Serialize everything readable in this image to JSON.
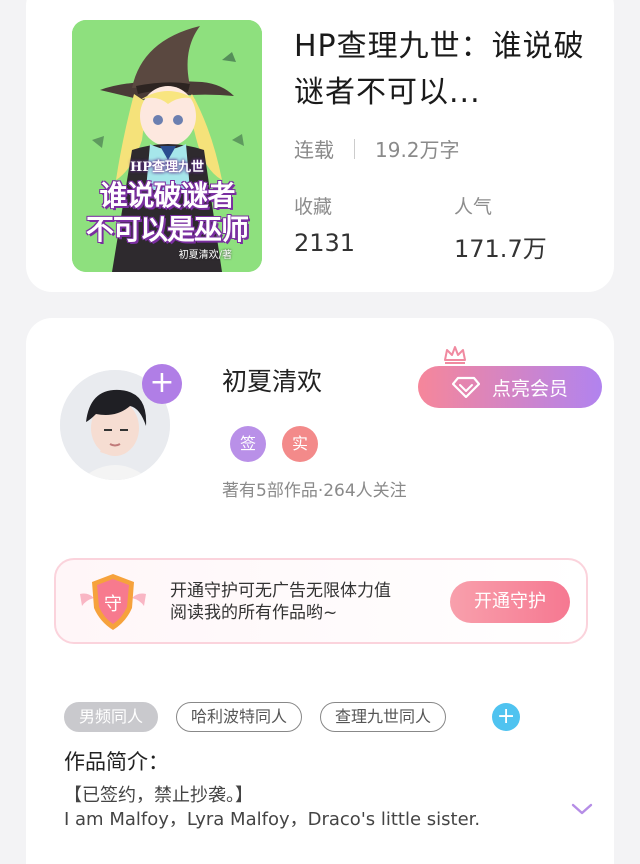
{
  "book": {
    "cover": {
      "series_text": "HP查理九世",
      "title_line1": "谁说破谜者",
      "title_line2": "不可以是巫师",
      "author_text": "初夏清欢/著"
    },
    "title": "HP查理九世：谁说破谜者不可以...",
    "status": "连载",
    "word_count": "19.2万字",
    "favorites_label": "收藏",
    "favorites_value": "2131",
    "popularity_label": "人气",
    "popularity_value": "171.7万"
  },
  "author": {
    "name": "初夏清欢",
    "follow_symbol": "+",
    "badges": [
      "签",
      "实"
    ],
    "stats": "著有5部作品·264人关注",
    "vip_button": "点亮会员"
  },
  "guard": {
    "icon_text": "守",
    "line1": "开通守护可无广告无限体力值",
    "line2": "阅读我的所有作品哟~",
    "button": "开通守护"
  },
  "tags": [
    "男频同人",
    "哈利波特同人",
    "查理九世同人"
  ],
  "tag_add_symbol": "+",
  "intro": {
    "title": "作品简介：",
    "line1": "【已签约，禁止抄袭。】",
    "line2": "I am Malfoy，Lyra Malfoy，Draco's little sister."
  },
  "colors": {
    "vip_gradient_start": "#f6869a",
    "vip_gradient_end": "#b183ef",
    "tag_add": "#4fc3f0",
    "badge_sign": "#b990e8",
    "badge_real": "#f38a8a"
  }
}
